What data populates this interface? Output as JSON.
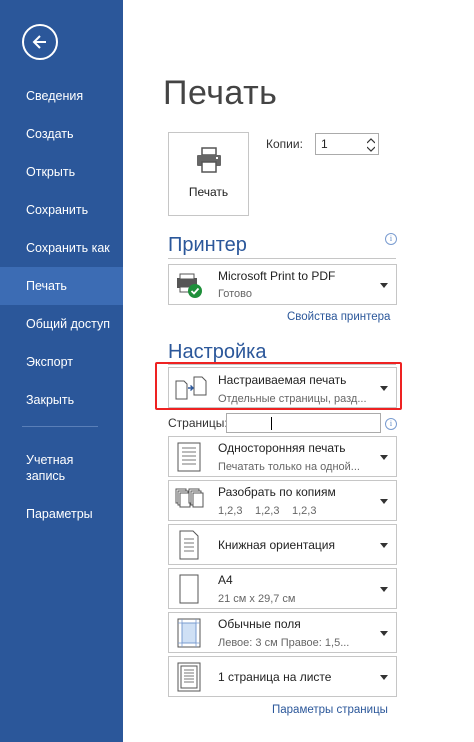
{
  "sidebar": {
    "back_icon": "arrow-left-icon",
    "items": [
      {
        "label": "Сведения"
      },
      {
        "label": "Создать"
      },
      {
        "label": "Открыть"
      },
      {
        "label": "Сохранить"
      },
      {
        "label": "Сохранить как"
      },
      {
        "label": "Печать"
      },
      {
        "label": "Общий доступ"
      },
      {
        "label": "Экспорт"
      },
      {
        "label": "Закрыть"
      },
      {
        "label": "Учетная запись"
      },
      {
        "label": "Параметры"
      }
    ],
    "active_item": "Печать",
    "colors": {
      "background": "#2b579a",
      "active": "#3c6cb4"
    }
  },
  "main": {
    "title": "Печать",
    "print_button": {
      "label": "Печать",
      "icon": "printer-icon"
    },
    "copies": {
      "label": "Копии:",
      "value": "1"
    }
  },
  "printer": {
    "heading": "Принтер",
    "name": "Microsoft Print to PDF",
    "status": "Готово",
    "icon": "printer-ready-icon",
    "properties_link": "Свойства принтера"
  },
  "settings": {
    "heading": "Настройка",
    "print_range": {
      "title": "Настраиваемая печать",
      "subtitle": "Отдельные страницы, разд..."
    },
    "pages": {
      "label": "Страницы:",
      "value": ""
    },
    "sides": {
      "title": "Односторонняя печать",
      "subtitle": "Печатать только на одной..."
    },
    "collate": {
      "title": "Разобрать по копиям",
      "orders": [
        "1,2,3",
        "1,2,3",
        "1,2,3"
      ]
    },
    "orientation": {
      "title": "Книжная ориентация"
    },
    "paper": {
      "title": "A4",
      "subtitle": "21 см x 29,7 см"
    },
    "margins": {
      "title": "Обычные поля",
      "subtitle": "Левое:  3 см    Правое:  1,5..."
    },
    "per_sheet": {
      "title": "1 страница на листе"
    },
    "page_setup_link": "Параметры страницы"
  },
  "accent_color": "#2b579a",
  "highlight_color": "#ee2222"
}
